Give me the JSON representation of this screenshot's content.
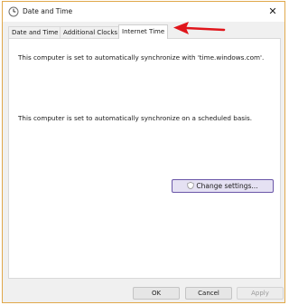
{
  "window": {
    "title": "Date and Time",
    "close_glyph": "✕"
  },
  "tabs": [
    {
      "label": "Date and Time",
      "active": false
    },
    {
      "label": "Additional Clocks",
      "active": false
    },
    {
      "label": "Internet Time",
      "active": true
    }
  ],
  "panel": {
    "sync_server_text": "This computer is set to automatically synchronize with 'time.windows.com'.",
    "schedule_text": "This computer is set to automatically synchronize on a scheduled basis.",
    "change_settings_label": "Change settings...",
    "change_settings_icon": "shield-icon"
  },
  "footer": {
    "ok_label": "OK",
    "cancel_label": "Cancel",
    "apply_label": "Apply"
  },
  "annotation": {
    "arrow_color": "#e0151b"
  },
  "colors": {
    "window_border": "#e0a84a",
    "accent_button_bg": "#e5e1f3",
    "accent_button_border": "#6a56a8"
  }
}
